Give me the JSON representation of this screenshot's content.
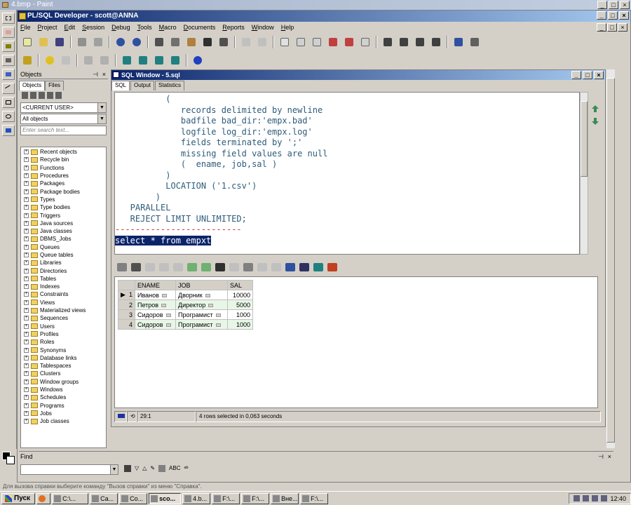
{
  "paint": {
    "title": "4.bmp - Paint",
    "status": "Для вызова справки выберите команду \"Вызов справки\" из меню \"Справка\"."
  },
  "app": {
    "title": "PL/SQL Developer - scott@ANNA",
    "menu": [
      "File",
      "Project",
      "Edit",
      "Session",
      "Debug",
      "Tools",
      "Macro",
      "Documents",
      "Reports",
      "Window",
      "Help"
    ]
  },
  "objects": {
    "title": "Objects",
    "tabs": [
      "Objects",
      "Files"
    ],
    "user_combo": "<CURRENT USER>",
    "filter_combo": "All objects",
    "search_placeholder": "Enter search text...",
    "tree": [
      "Recent objects",
      "Recycle bin",
      "Functions",
      "Procedures",
      "Packages",
      "Package bodies",
      "Types",
      "Type bodies",
      "Triggers",
      "Java sources",
      "Java classes",
      "DBMS_Jobs",
      "Queues",
      "Queue tables",
      "Libraries",
      "Directories",
      "Tables",
      "Indexes",
      "Constraints",
      "Views",
      "Materialized views",
      "Sequences",
      "Users",
      "Profiles",
      "Roles",
      "Synonyms",
      "Database links",
      "Tablespaces",
      "Clusters",
      "Window groups",
      "Windows",
      "Schedules",
      "Programs",
      "Jobs",
      "Job classes"
    ]
  },
  "sql_window": {
    "title": "SQL Window - 5.sql",
    "tabs": [
      "SQL",
      "Output",
      "Statistics"
    ],
    "lines": [
      "          (",
      "             records delimited by newline",
      "             badfile bad_dir:'empx.bad'",
      "             logfile log_dir:'empx.log'",
      "             fields terminated by ';'",
      "             missing field values are null",
      "             (  ename, job,sal )",
      "          )",
      "          LOCATION ('1.csv')",
      "        )",
      "   PARALLEL",
      "   REJECT LIMIT UNLIMITED;",
      "-------------------------",
      "select * from empxt"
    ],
    "grid": {
      "columns": [
        "ENAME",
        "JOB",
        "SAL"
      ],
      "rows": [
        [
          "1",
          "Иванов",
          "Дворник",
          "10000"
        ],
        [
          "2",
          "Петров",
          "Директор",
          "5000"
        ],
        [
          "3",
          "Сидоров",
          "Програмист",
          "1000"
        ],
        [
          "4",
          "Сидоров",
          "Програмист",
          "1000"
        ]
      ]
    },
    "status": {
      "position": "29:1",
      "message": "4 rows selected in 0,063 seconds"
    }
  },
  "find": {
    "title": "Find",
    "value": ""
  },
  "taskbar": {
    "start": "Пуск",
    "buttons": [
      "C:\\...",
      "Ca...",
      "Co...",
      "sco...",
      "4.b...",
      "F:\\...",
      "F:\\...",
      "Вне...",
      "F:\\..."
    ],
    "clock": "12:40"
  }
}
